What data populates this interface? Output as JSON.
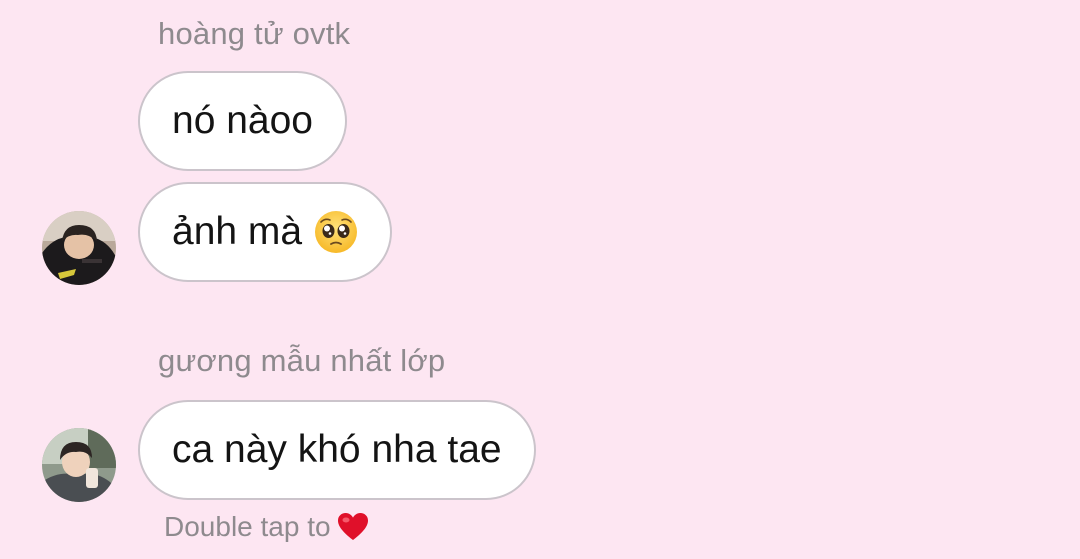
{
  "thread": {
    "groups": [
      {
        "sender": "hoàng tử ovtk",
        "messages": [
          "nó nàoo",
          "ảnh mà"
        ],
        "avatar_icon": "profile-photo-dark-hoodie"
      },
      {
        "sender": "gương mẫu nhất lớp",
        "messages": [
          "ca này khó nha tae"
        ],
        "avatar_icon": "profile-photo-outdoor"
      }
    ],
    "emoji_icon": "pleading-face-emoji",
    "hint": {
      "text": "Double tap to",
      "icon": "red-heart-icon"
    }
  },
  "colors": {
    "background": "#fde6f2",
    "bubble": "#ffffff",
    "bubble_border": "#cbc4cb",
    "meta_text": "#8e8a8e",
    "heart": "#e0102a"
  }
}
